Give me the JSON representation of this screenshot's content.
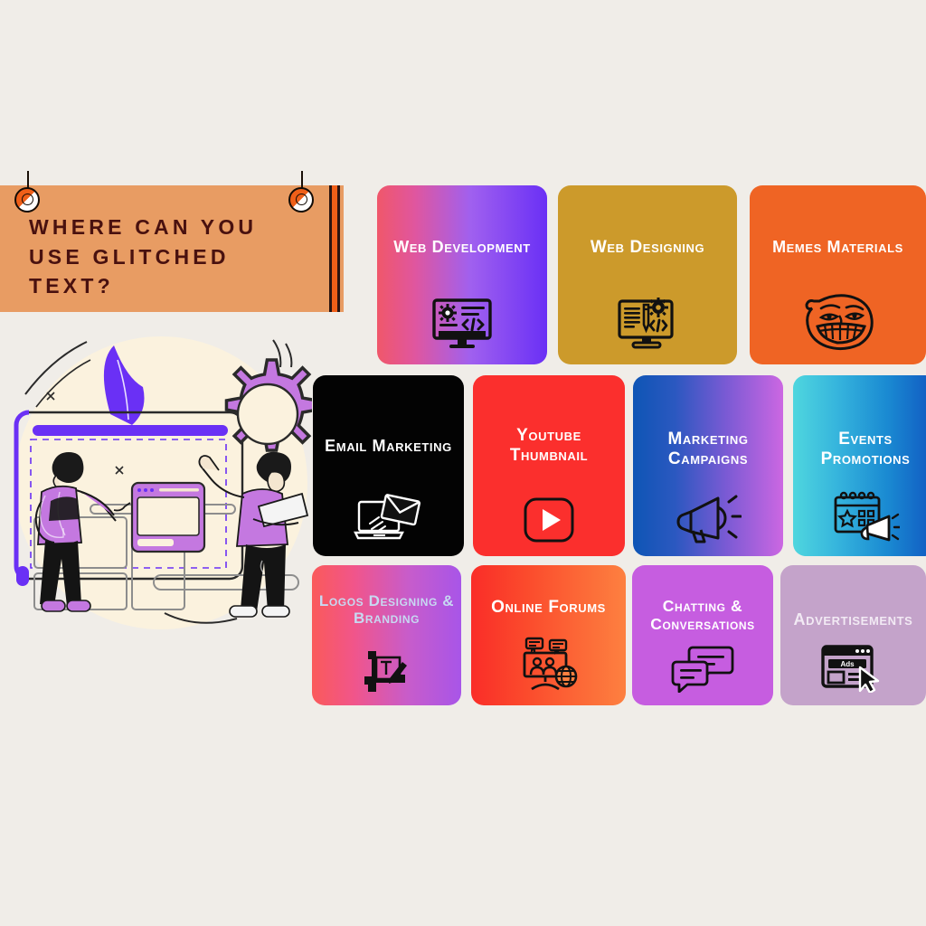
{
  "page": {
    "background_color": "#f0ede8"
  },
  "banner": {
    "title": "Where can you use glitched text?",
    "background_color": "#e89c63",
    "text_color": "#49110f",
    "accent_stripe_color": "#ef5f18",
    "pin_left_icon": "pin-knob-icon",
    "pin_right_icon": "pin-knob-icon"
  },
  "illustration": {
    "name": "web-design-team-illustration",
    "accent_color": "#6a30f5",
    "secondary_color": "#c478e0",
    "backdrop_color": "#fbf2de"
  },
  "cards": [
    {
      "id": "web-development",
      "label": "Web Development",
      "icon": "monitor-gear-code-icon",
      "text_color": "#ffffff",
      "gradient_from": "#f0576a",
      "gradient_to": "#6a30f5"
    },
    {
      "id": "web-designing",
      "label": "Web Designing",
      "icon": "monitor-pen-gear-code-icon",
      "text_color": "#ffffff",
      "background": "#cc9a2b"
    },
    {
      "id": "memes-materials",
      "label": "Memes Materials",
      "icon": "troll-face-icon",
      "text_color": "#ffffff",
      "background": "#ef6424"
    },
    {
      "id": "email-marketing",
      "label": "Email Marketing",
      "icon": "laptop-envelope-icon",
      "text_color": "#ffffff",
      "background": "#030303"
    },
    {
      "id": "youtube-thumbnail",
      "label": "Youtube Thumbnail",
      "icon": "youtube-play-icon",
      "text_color": "#ffffff",
      "background": "#fb2f2d"
    },
    {
      "id": "marketing-campaigns",
      "label": "Marketing Campaigns",
      "icon": "megaphone-icon",
      "text_color": "#ffffff",
      "gradient_from": "#0e55b5",
      "gradient_to": "#cc67e2"
    },
    {
      "id": "events-promotions",
      "label": "Events Promotions",
      "icon": "calendar-megaphone-icon",
      "text_color": "#ffffff",
      "gradient_from": "#4fd6de",
      "gradient_to": "#1055c0"
    },
    {
      "id": "logos-branding",
      "label": "Logos designing & Branding",
      "icon": "crop-pen-icon",
      "text_color": "#c7d9f2",
      "gradient_from": "#fa5a5a",
      "gradient_to": "#a855e8"
    },
    {
      "id": "online-forums",
      "label": "Online Forums",
      "icon": "forum-people-globe-icon",
      "text_color": "#ffffff",
      "gradient_from": "#fa2d28",
      "gradient_to": "#fd8040"
    },
    {
      "id": "chatting-conversations",
      "label": "Chatting & Conversations",
      "icon": "speech-bubbles-icon",
      "text_color": "#ffffff",
      "background": "#c65de0"
    },
    {
      "id": "advertisements",
      "label": "Advertisements",
      "icon": "browser-ads-cursor-icon",
      "icon_text": "Ads",
      "text_color": "#f2eaf4",
      "background": "#c4a3ca"
    }
  ]
}
